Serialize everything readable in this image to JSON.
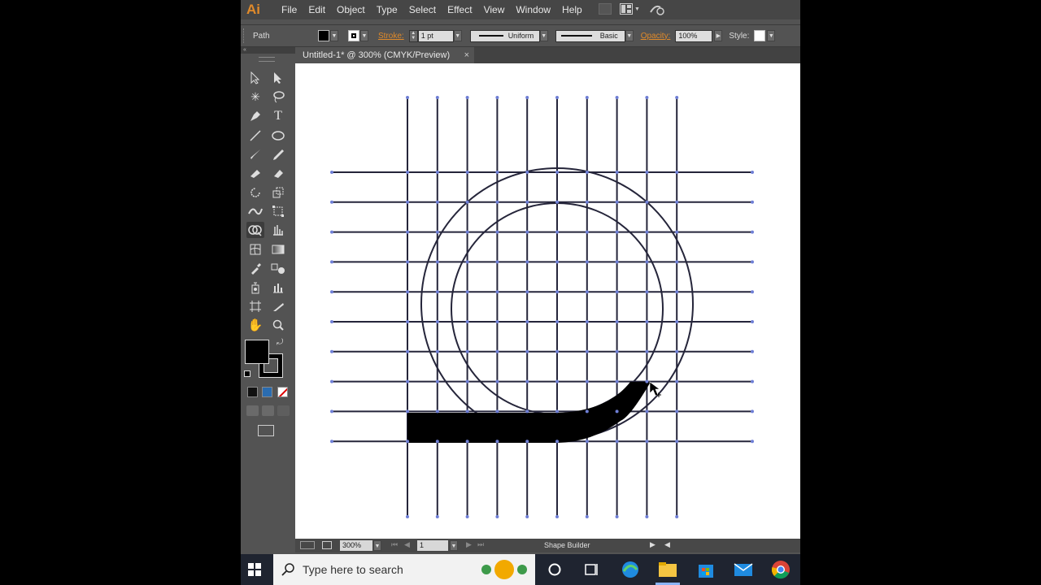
{
  "app": {
    "logo": "Ai"
  },
  "menu": [
    "File",
    "Edit",
    "Object",
    "Type",
    "Select",
    "Effect",
    "View",
    "Window",
    "Help"
  ],
  "control_bar": {
    "selection_label": "Path",
    "stroke_label": "Stroke:",
    "stroke_weight": "1 pt",
    "stroke_profile": "Uniform",
    "brush": "Basic",
    "opacity_label": "Opacity:",
    "opacity_value": "100%",
    "style_label": "Style:"
  },
  "document_tab": {
    "title": "Untitled-1* @ 300% (CMYK/Preview)",
    "close": "×"
  },
  "status_bar": {
    "zoom": "300%",
    "artboard_number": "1",
    "current_tool": "Shape Builder"
  },
  "taskbar": {
    "search_placeholder": "Type here to search"
  },
  "colors": {
    "path_stroke": "#25253a",
    "anchor": "#6f7fd6",
    "fill_selected": "#000000",
    "accent": "#e08a2a"
  },
  "tools": [
    "selection-tool",
    "direct-selection-tool",
    "magic-wand-tool",
    "lasso-tool",
    "pen-tool",
    "type-tool",
    "line-tool",
    "ellipse-tool",
    "paintbrush-tool",
    "pencil-tool",
    "blob-brush-tool",
    "eraser-tool",
    "rotate-tool",
    "scale-tool",
    "width-tool",
    "free-transform-tool",
    "shape-builder-tool",
    "graph-tool",
    "mesh-tool",
    "gradient-tool",
    "eyedropper-tool",
    "blend-tool",
    "symbol-sprayer-tool",
    "column-graph-tool",
    "artboard-tool",
    "slice-tool",
    "hand-tool",
    "zoom-tool"
  ]
}
